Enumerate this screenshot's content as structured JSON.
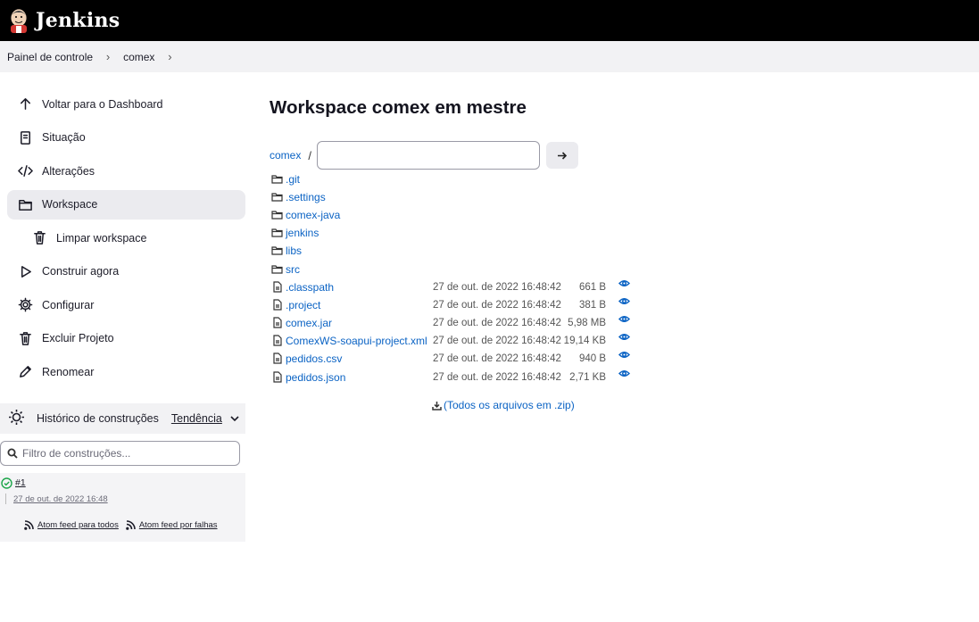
{
  "header": {
    "brand": "Jenkins",
    "logo_icon": "jenkins-butler-logo"
  },
  "breadcrumb": [
    "Painel de controle",
    "comex"
  ],
  "sidebar": {
    "tasks": [
      {
        "label": "Voltar para o Dashboard",
        "icon": "arrow-up-icon"
      },
      {
        "label": "Situação",
        "icon": "document-icon"
      },
      {
        "label": "Alterações",
        "icon": "code-icon"
      },
      {
        "label": "Workspace",
        "icon": "folder-icon",
        "active": true
      },
      {
        "label": "Limpar workspace",
        "icon": "trash-icon",
        "sub": true
      },
      {
        "label": "Construir agora",
        "icon": "play-icon"
      },
      {
        "label": "Configurar",
        "icon": "gear-icon"
      },
      {
        "label": "Excluir Projeto",
        "icon": "trash-icon"
      },
      {
        "label": "Renomear",
        "icon": "pencil-icon"
      }
    ],
    "history": {
      "title": "Histórico de construções",
      "trend": "Tendência"
    },
    "filter_placeholder": "Filtro de construções...",
    "build": {
      "number": "#1",
      "date": "27 de out. de 2022 16:48",
      "status_color": "#1ea64b"
    },
    "feeds": {
      "all": "Atom feed para todos",
      "failures": "Atom feed por falhas"
    }
  },
  "main": {
    "title": "Workspace comex em mestre",
    "path_root": "comex",
    "path_separator": "/",
    "folders": [
      ".git",
      ".settings",
      "comex-java",
      "jenkins",
      "libs",
      "src"
    ],
    "files": [
      {
        "name": ".classpath",
        "date": "27 de out. de 2022 16:48:42",
        "size": "661 B"
      },
      {
        "name": ".project",
        "date": "27 de out. de 2022 16:48:42",
        "size": "381 B"
      },
      {
        "name": "comex.jar",
        "date": "27 de out. de 2022 16:48:42",
        "size": "5,98 MB"
      },
      {
        "name": "ComexWS-soapui-project.xml",
        "date": "27 de out. de 2022 16:48:42",
        "size": "19,14 KB"
      },
      {
        "name": "pedidos.csv",
        "date": "27 de out. de 2022 16:48:42",
        "size": "940 B"
      },
      {
        "name": "pedidos.json",
        "date": "27 de out. de 2022 16:48:42",
        "size": "2,71 KB"
      }
    ],
    "zip_label": "(Todos os arquivos em .zip)"
  },
  "colors": {
    "link": "#0b63c4",
    "header_bg": "#000000",
    "active_bg": "#ebebef"
  }
}
